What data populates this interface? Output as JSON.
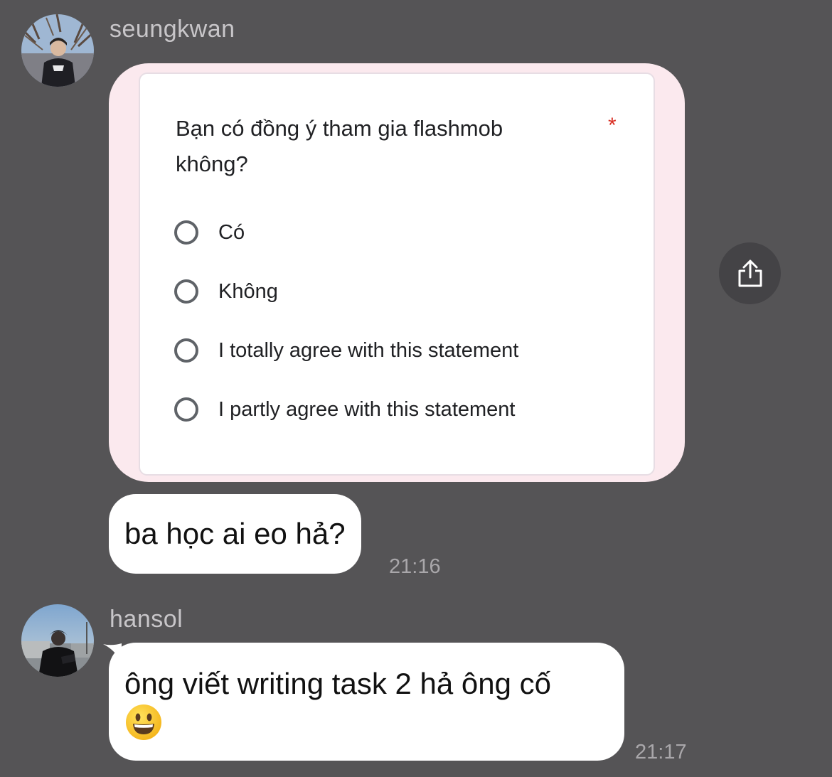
{
  "messages": [
    {
      "sender": "seungkwan",
      "image": {
        "question": "Bạn có đồng ý tham gia flashmob không?",
        "required_mark": "*",
        "options": [
          "Có",
          "Không",
          "I totally agree with this statement",
          "I partly agree with this statement"
        ]
      },
      "text": "ba học ai eo hả?",
      "time": "21:16"
    },
    {
      "sender": "hansol",
      "text": "ông viết writing task 2 hả ông cố",
      "emoji": "grinning-face",
      "time": "21:17"
    }
  ],
  "icons": {
    "share": "share-upload-icon"
  },
  "colors": {
    "background": "#555456",
    "bubble": "#ffffff",
    "image_frame": "#fbe9ee",
    "required": "#d93025"
  }
}
